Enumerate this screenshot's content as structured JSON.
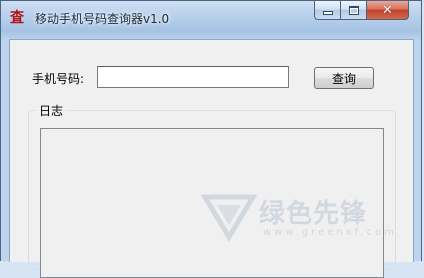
{
  "window": {
    "title": "移动手机号码查询器v1.0",
    "icon": "app-logo-icon",
    "icon_glyph": "査"
  },
  "caption_buttons": {
    "minimize_icon": "minimize-icon",
    "maximize_icon": "maximize-icon",
    "close_icon": "close-icon",
    "close_glyph": "✕"
  },
  "form": {
    "phone_label": "手机号码:",
    "phone_value": "",
    "query_button_label": "查询"
  },
  "log": {
    "legend": "日志",
    "content": ""
  },
  "watermark": {
    "text": "绿色先锋",
    "url": "www.greenxf.com"
  },
  "colors": {
    "titlebar": "#b9d1ec",
    "close_button": "#c0412a",
    "client_bg": "#f0f0f0"
  }
}
